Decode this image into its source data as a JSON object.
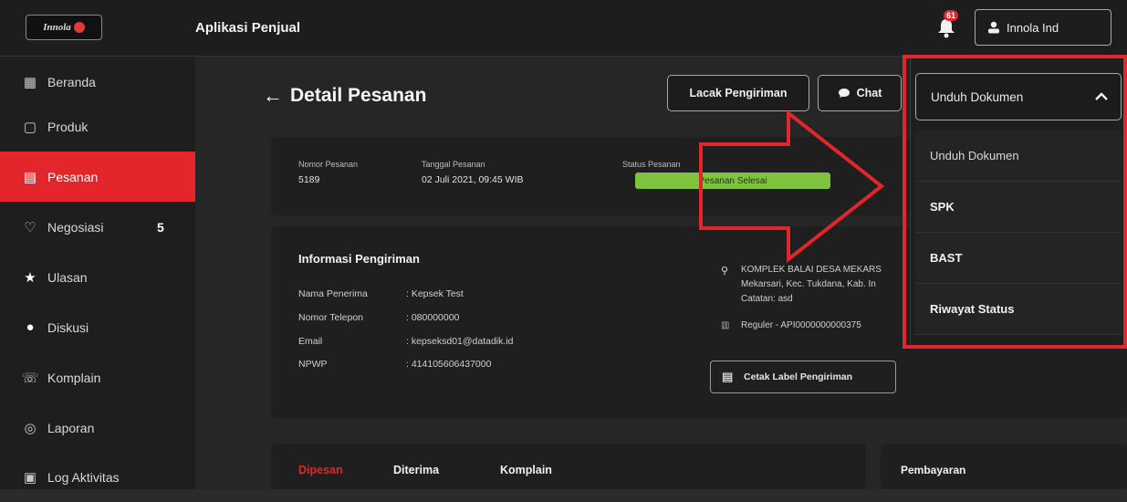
{
  "app": {
    "logo": "Innola",
    "title": "Aplikasi Penjual"
  },
  "header": {
    "notif_count": "61",
    "user_name": "Innola Ind"
  },
  "sidebar": {
    "items": [
      {
        "label": "Beranda",
        "icon": "store-icon"
      },
      {
        "label": "Produk",
        "icon": "product-icon"
      },
      {
        "label": "Pesanan",
        "icon": "order-icon",
        "active": true
      },
      {
        "label": "Negosiasi",
        "icon": "handshake-icon",
        "count": "5"
      },
      {
        "label": "Ulasan",
        "icon": "star-icon"
      },
      {
        "label": "Diskusi",
        "icon": "chat-icon"
      },
      {
        "label": "Komplain",
        "icon": "complaint-icon"
      },
      {
        "label": "Laporan",
        "icon": "report-icon"
      },
      {
        "label": "Log Aktivitas",
        "icon": "log-icon"
      }
    ]
  },
  "page": {
    "title": "Detail Pesanan",
    "back": "←"
  },
  "actions": {
    "track_label": "Lacak Pengiriman",
    "chat_label": "Chat",
    "download_label": "Unduh Dokumen"
  },
  "order": {
    "number_label": "Nomor Pesanan",
    "number": "5189",
    "date_label": "Tanggal Pesanan",
    "date": "02 Juli 2021, 09:45 WIB",
    "status_label": "Status Pesanan",
    "status": "Pesanan Selesai"
  },
  "shipping": {
    "heading": "Informasi Pengiriman",
    "rows": [
      {
        "label": "Nama Penerima",
        "value": ": Kepsek Test"
      },
      {
        "label": "Nomor Telepon",
        "value": ": 080000000"
      },
      {
        "label": "Email",
        "value": ": kepseksd01@datadik.id"
      },
      {
        "label": "NPWP",
        "value": ": 414105606437000"
      }
    ],
    "address_line1": "KOMPLEK BALAI DESA MEKARS",
    "address_line2": "Mekarsari, Kec. Tukdana, Kab. In",
    "note": "Catatan: asd",
    "courier": "Reguler - API0000000000375",
    "print_label": "Cetak Label Pengiriman"
  },
  "tabs": {
    "ordered": "Dipesan",
    "received": "Diterima",
    "complaint": "Komplain"
  },
  "payment": {
    "heading": "Pembayaran"
  },
  "dropdown": {
    "header": "Unduh Dokumen",
    "options": [
      "Unduh Dokumen",
      "SPK",
      "BAST",
      "Riwayat Status"
    ]
  },
  "colors": {
    "accent": "#e2262b",
    "success": "#7ec23e",
    "background": "#262626"
  }
}
